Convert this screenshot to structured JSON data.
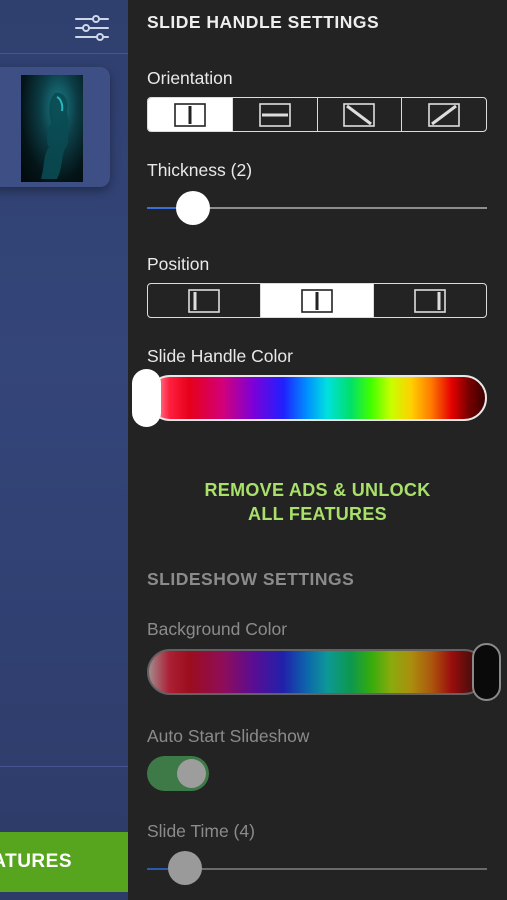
{
  "left": {
    "features_button_label": "ATURES"
  },
  "slide_handle": {
    "title": "SLIDE HANDLE SETTINGS",
    "orientation_label": "Orientation",
    "orientation_options": [
      "vertical-line-icon",
      "horizontal-line-icon",
      "diagonal-down-icon",
      "diagonal-up-icon"
    ],
    "orientation_selected": 0,
    "thickness_label": "Thickness (2)",
    "thickness_value": 2,
    "position_label": "Position",
    "position_options": [
      "position-left-icon",
      "position-center-icon",
      "position-right-icon"
    ],
    "position_selected": 1,
    "color_label": "Slide Handle Color"
  },
  "unlock": {
    "line1": "REMOVE ADS & UNLOCK",
    "line2": "ALL FEATURES",
    "color": "#a8e06a"
  },
  "slideshow": {
    "title": "SLIDESHOW SETTINGS",
    "background_label": "Background Color",
    "autostart_label": "Auto Start Slideshow",
    "autostart_on": true,
    "slide_time_label": "Slide Time (4)",
    "slide_time_value": 4
  },
  "colors": {
    "accent_blue": "#3a6fd8",
    "feature_green": "#57a51f",
    "toggle_green": "#3d7a47"
  }
}
